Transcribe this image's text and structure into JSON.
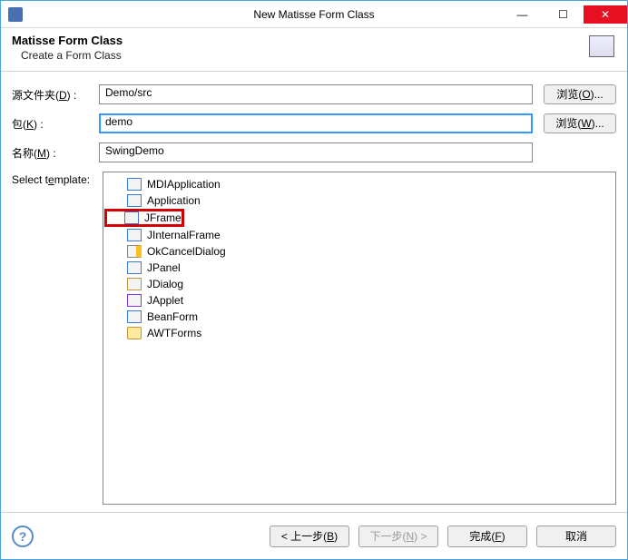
{
  "window": {
    "title": "New Matisse Form Class"
  },
  "header": {
    "title": "Matisse Form Class",
    "subtitle": "Create a Form Class"
  },
  "form": {
    "sourceFolder": {
      "label_pre": "源文件夹(",
      "label_u": "D",
      "label_post": ") :",
      "value": "Demo/src",
      "browse_pre": "浏览(",
      "browse_u": "O",
      "browse_post": ")..."
    },
    "package": {
      "label_pre": "包(",
      "label_u": "K",
      "label_post": ") :",
      "value": "demo",
      "browse_pre": "浏览(",
      "browse_u": "W",
      "browse_post": ")..."
    },
    "name": {
      "label_pre": "名称(",
      "label_u": "M",
      "label_post": ") :",
      "value": "SwingDemo"
    },
    "template": {
      "label_pre": "Select t",
      "label_u": "e",
      "label_post": "mplate:"
    }
  },
  "templates": [
    {
      "label": "MDIApplication",
      "icon": "app"
    },
    {
      "label": "Application",
      "icon": "app"
    },
    {
      "label": "JFrame",
      "icon": "app",
      "highlight": true
    },
    {
      "label": "JInternalFrame",
      "icon": "app"
    },
    {
      "label": "OkCancelDialog",
      "icon": "okc"
    },
    {
      "label": "JPanel",
      "icon": "app"
    },
    {
      "label": "JDialog",
      "icon": "dialog"
    },
    {
      "label": "JApplet",
      "icon": "applet"
    },
    {
      "label": "BeanForm",
      "icon": "app"
    },
    {
      "label": "AWTForms",
      "icon": "folder"
    }
  ],
  "buttons": {
    "back": {
      "pre": "< 上一步(",
      "u": "B",
      "post": ")"
    },
    "next": {
      "pre": "下一步(",
      "u": "N",
      "post": ") >"
    },
    "finish": {
      "pre": "完成(",
      "u": "F",
      "post": ")"
    },
    "cancel": {
      "text": "取消"
    }
  }
}
